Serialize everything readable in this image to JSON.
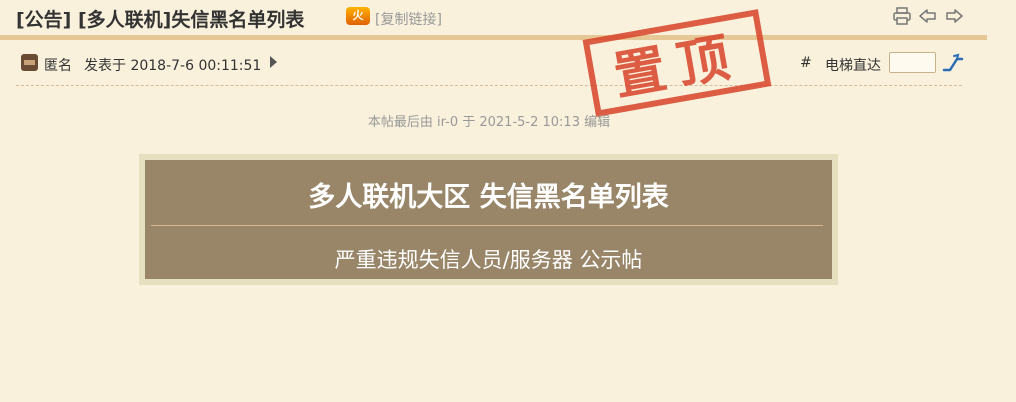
{
  "thread": {
    "title": "[公告] [多人联机]失信黑名单列表",
    "hot_badge": "火",
    "copy_link_label": "[复制链接]"
  },
  "toolbar_icons": [
    "printer-icon",
    "previous-thread-icon",
    "next-thread-icon"
  ],
  "post": {
    "author": "匿名",
    "posted_at": "发表于 2018-7-6 00:11:51",
    "floor_hash": "#",
    "elevator_label": "电梯直达",
    "elevator_value": "",
    "stamp_text": "置顶",
    "edit_note": "本帖最后由 ir-0 于 2021-5-2 10:13 编辑"
  },
  "banner": {
    "title": "多人联机大区 失信黑名单列表",
    "subtitle": "严重违规失信人员/服务器 公示帖"
  },
  "colors": {
    "page_bg": "#f9f1dc",
    "title_rule": "#e6c796",
    "banner_bg": "#998669",
    "banner_frame": "#e6dfc0",
    "stamp": "#d8432a",
    "elevator_icon": "#2a6db5"
  }
}
